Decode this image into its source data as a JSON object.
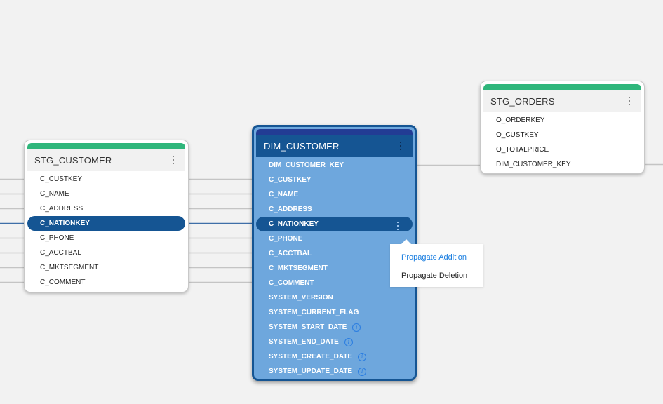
{
  "nodes": {
    "stg_customer": {
      "title": "STG_CUSTOMER",
      "header_color": "#2fb67b",
      "fields": [
        "C_CUSTKEY",
        "C_NAME",
        "C_ADDRESS",
        "C_NATIONKEY",
        "C_PHONE",
        "C_ACCTBAL",
        "C_MKTSEGMENT",
        "C_COMMENT"
      ],
      "selected_field": "C_NATIONKEY"
    },
    "dim_customer": {
      "title": "DIM_CUSTOMER",
      "header_color": "#223c94",
      "fields": [
        {
          "name": "DIM_CUSTOMER_KEY",
          "info": false
        },
        {
          "name": "C_CUSTKEY",
          "info": false
        },
        {
          "name": "C_NAME",
          "info": false
        },
        {
          "name": "C_ADDRESS",
          "info": false
        },
        {
          "name": "C_NATIONKEY",
          "info": false
        },
        {
          "name": "C_PHONE",
          "info": false
        },
        {
          "name": "C_ACCTBAL",
          "info": false
        },
        {
          "name": "C_MKTSEGMENT",
          "info": false
        },
        {
          "name": "C_COMMENT",
          "info": false
        },
        {
          "name": "SYSTEM_VERSION",
          "info": false
        },
        {
          "name": "SYSTEM_CURRENT_FLAG",
          "info": false
        },
        {
          "name": "SYSTEM_START_DATE",
          "info": true
        },
        {
          "name": "SYSTEM_END_DATE",
          "info": true
        },
        {
          "name": "SYSTEM_CREATE_DATE",
          "info": true
        },
        {
          "name": "SYSTEM_UPDATE_DATE",
          "info": true
        }
      ],
      "selected_field": "C_NATIONKEY",
      "info_glyph": "i"
    },
    "stg_orders": {
      "title": "STG_ORDERS",
      "header_color": "#2fb67b",
      "fields": [
        "O_ORDERKEY",
        "O_CUSTKEY",
        "O_TOTALPRICE",
        "DIM_CUSTOMER_KEY"
      ]
    }
  },
  "context_menu": {
    "items": [
      {
        "label": "Propagate Addition",
        "active": true
      },
      {
        "label": "Propagate Deletion",
        "active": false
      }
    ]
  },
  "colors": {
    "selected": "#155593",
    "link": "#c4c4c4",
    "link_selected": "#3f6fa8",
    "accent_link": "#1a7ee0"
  }
}
